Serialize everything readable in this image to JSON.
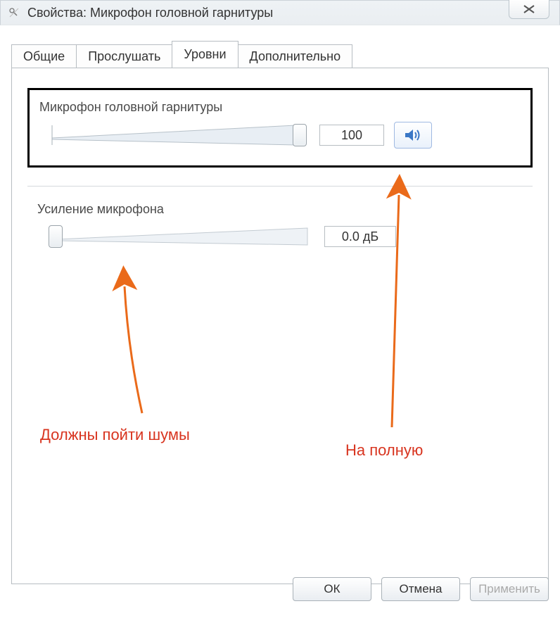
{
  "window": {
    "title": "Свойства: Микрофон головной гарнитуры"
  },
  "tabs": {
    "general": "Общие",
    "listen": "Прослушать",
    "levels": "Уровни",
    "advanced": "Дополнительно"
  },
  "levels": {
    "mic": {
      "label": "Микрофон головной гарнитуры",
      "value": "100",
      "slider_percent": 100
    },
    "boost": {
      "label": "Усиление микрофона",
      "value": "0.0 дБ",
      "slider_percent": 0
    }
  },
  "annotations": {
    "noise": "Должны пойти шумы",
    "full": "На полную"
  },
  "buttons": {
    "ok": "ОК",
    "cancel": "Отмена",
    "apply": "Применить"
  },
  "icons": {
    "app": "mic-icon",
    "close": "✕",
    "speaker": "speaker-icon"
  }
}
